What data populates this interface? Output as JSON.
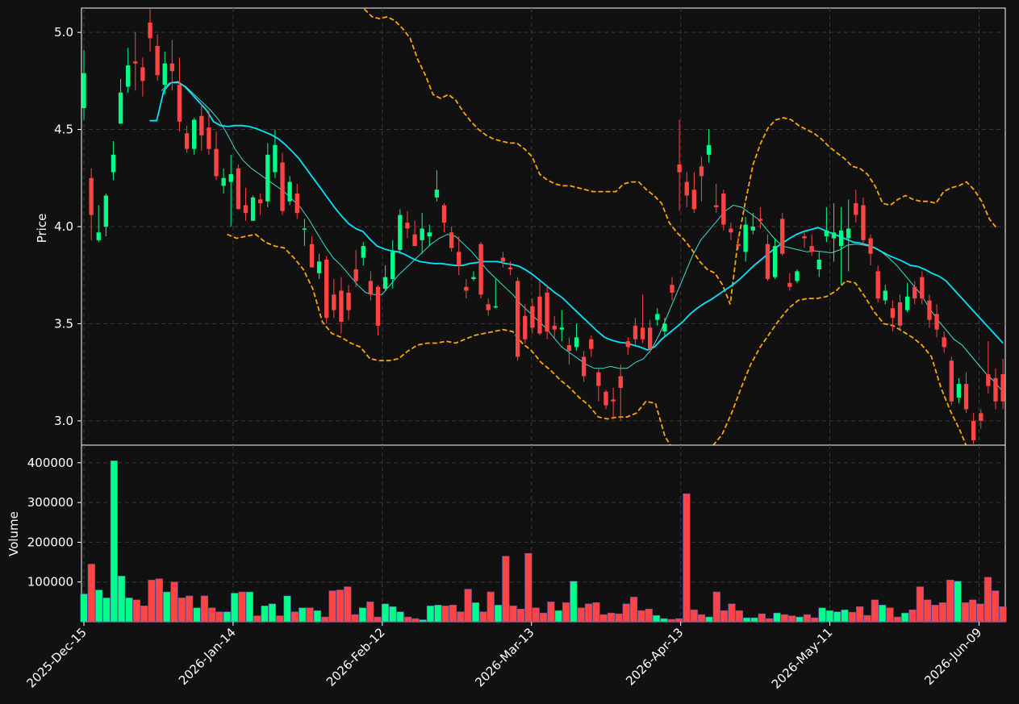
{
  "chart_data": {
    "type": "candlestick",
    "theme": {
      "background": "#111111",
      "up_color": "#00ff88",
      "down_color": "#ff4444",
      "ma_fast_color": "#00e5ff",
      "ma_slow_color": "#40e0d0",
      "band_color": "#ffa500",
      "grid": true
    },
    "price_panel": {
      "ylabel": "Price",
      "ylim": [
        2.875,
        5.125
      ],
      "yticks": [
        3.0,
        3.5,
        4.0,
        4.5,
        5.0
      ],
      "ytick_labels": [
        "3.0",
        "3.5",
        "4.0",
        "4.5",
        "5.0"
      ]
    },
    "volume_panel": {
      "ylabel": "Volume",
      "ylim": [
        0,
        420000
      ],
      "yticks": [
        100000,
        200000,
        300000,
        400000
      ],
      "ytick_labels": [
        "100000",
        "200000",
        "300000",
        "400000"
      ]
    },
    "x_tick_labels": [
      "2025-Dec-15",
      "2026-Jan-14",
      "2026-Feb-12",
      "2026-Mar-13",
      "2026-Apr-13",
      "2026-May-11",
      "2026-Jun-09"
    ],
    "x_tick_index": [
      0,
      25,
      50,
      75,
      100,
      125,
      150
    ],
    "n_bars": 155,
    "candles": [
      [
        4.61,
        4.79,
        4.91,
        4.55
      ],
      [
        4.25,
        4.06,
        4.3,
        3.93
      ],
      [
        3.93,
        3.97,
        4.11,
        3.92
      ],
      [
        4.0,
        4.16,
        4.17,
        3.95
      ],
      [
        4.28,
        4.37,
        4.44,
        4.24
      ],
      [
        4.53,
        4.69,
        4.76,
        4.53
      ],
      [
        4.72,
        4.83,
        4.92,
        4.69
      ],
      [
        4.85,
        4.84,
        5.0,
        4.7
      ],
      [
        4.82,
        4.75,
        4.87,
        4.67
      ],
      [
        5.05,
        4.97,
        5.12,
        4.9
      ],
      [
        4.93,
        4.78,
        4.99,
        4.75
      ],
      [
        4.73,
        4.84,
        4.9,
        4.68
      ],
      [
        4.84,
        4.8,
        4.96,
        4.7
      ],
      [
        4.73,
        4.54,
        4.87,
        4.49
      ],
      [
        4.48,
        4.4,
        4.52,
        4.38
      ],
      [
        4.4,
        4.55,
        4.56,
        4.37
      ],
      [
        4.57,
        4.47,
        4.63,
        4.39
      ],
      [
        4.51,
        4.4,
        4.6,
        4.37
      ],
      [
        4.4,
        4.26,
        4.49,
        4.24
      ],
      [
        4.21,
        4.25,
        4.3,
        4.17
      ],
      [
        4.23,
        4.27,
        4.37,
        4.0
      ],
      [
        4.3,
        4.09,
        4.32,
        4.09
      ],
      [
        4.11,
        4.07,
        4.2,
        4.03
      ],
      [
        4.03,
        4.15,
        4.16,
        4.03
      ],
      [
        4.14,
        4.12,
        4.17,
        4.06
      ],
      [
        4.13,
        4.37,
        4.43,
        4.1
      ],
      [
        4.28,
        4.42,
        4.5,
        4.25
      ],
      [
        4.33,
        4.08,
        4.38,
        4.06
      ],
      [
        4.13,
        4.23,
        4.26,
        4.11
      ],
      [
        4.17,
        4.07,
        4.22,
        4.04
      ],
      [
        3.99,
        3.99,
        4.04,
        3.9
      ],
      [
        3.91,
        3.79,
        3.95,
        3.79
      ],
      [
        3.76,
        3.82,
        3.86,
        3.73
      ],
      [
        3.83,
        3.53,
        3.85,
        3.5
      ],
      [
        3.65,
        3.57,
        3.73,
        3.53
      ],
      [
        3.67,
        3.51,
        3.74,
        3.45
      ],
      [
        3.66,
        3.57,
        3.7,
        3.52
      ],
      [
        3.78,
        3.72,
        3.88,
        3.69
      ],
      [
        3.84,
        3.9,
        3.92,
        3.8
      ],
      [
        3.72,
        3.65,
        3.77,
        3.62
      ],
      [
        3.69,
        3.49,
        3.7,
        3.44
      ],
      [
        3.68,
        3.74,
        3.8,
        3.67
      ],
      [
        3.73,
        3.87,
        3.93,
        3.68
      ],
      [
        3.88,
        4.06,
        4.09,
        3.86
      ],
      [
        4.02,
        3.99,
        4.08,
        3.94
      ],
      [
        3.96,
        3.9,
        4.03,
        3.9
      ],
      [
        3.93,
        3.99,
        4.07,
        3.86
      ],
      [
        3.95,
        3.97,
        4.01,
        3.9
      ],
      [
        4.15,
        4.19,
        4.29,
        4.13
      ],
      [
        4.11,
        4.02,
        4.12,
        3.97
      ],
      [
        3.97,
        3.89,
        4.0,
        3.87
      ],
      [
        3.87,
        3.8,
        3.95,
        3.75
      ],
      [
        3.69,
        3.67,
        3.73,
        3.63
      ],
      [
        3.73,
        3.74,
        3.77,
        3.72
      ],
      [
        3.91,
        3.65,
        3.92,
        3.63
      ],
      [
        3.6,
        3.57,
        3.63,
        3.54
      ],
      [
        3.59,
        3.59,
        3.73,
        3.58
      ],
      [
        3.84,
        3.82,
        3.87,
        3.79
      ],
      [
        3.79,
        3.78,
        3.82,
        3.75
      ],
      [
        3.72,
        3.33,
        3.74,
        3.31
      ],
      [
        3.54,
        3.42,
        3.6,
        3.4
      ],
      [
        3.59,
        3.48,
        3.63,
        3.45
      ],
      [
        3.64,
        3.45,
        3.72,
        3.44
      ],
      [
        3.66,
        3.46,
        3.7,
        3.42
      ],
      [
        3.49,
        3.47,
        3.54,
        3.42
      ],
      [
        3.47,
        3.48,
        3.57,
        3.41
      ],
      [
        3.39,
        3.36,
        3.43,
        3.29
      ],
      [
        3.38,
        3.43,
        3.5,
        3.36
      ],
      [
        3.33,
        3.23,
        3.36,
        3.2
      ],
      [
        3.42,
        3.37,
        3.44,
        3.33
      ],
      [
        3.25,
        3.18,
        3.27,
        3.1
      ],
      [
        3.15,
        3.08,
        3.16,
        3.06
      ],
      [
        3.11,
        3.1,
        3.17,
        3.01
      ],
      [
        3.23,
        3.17,
        3.29,
        3.0
      ],
      [
        3.41,
        3.38,
        3.43,
        3.34
      ],
      [
        3.49,
        3.42,
        3.53,
        3.39
      ],
      [
        3.48,
        3.42,
        3.65,
        3.4
      ],
      [
        3.48,
        3.37,
        3.52,
        3.35
      ],
      [
        3.52,
        3.55,
        3.58,
        3.49
      ],
      [
        3.46,
        3.5,
        3.53,
        3.43
      ],
      [
        3.7,
        3.66,
        3.74,
        3.62
      ],
      [
        4.32,
        4.28,
        4.55,
        4.08
      ],
      [
        4.23,
        4.16,
        4.28,
        4.1
      ],
      [
        4.19,
        4.09,
        4.28,
        4.07
      ],
      [
        4.31,
        4.26,
        4.36,
        4.13
      ],
      [
        4.37,
        4.42,
        4.5,
        4.33
      ],
      [
        4.11,
        4.1,
        4.22,
        4.07
      ],
      [
        4.17,
        4.01,
        4.19,
        3.98
      ],
      [
        3.99,
        3.97,
        4.02,
        3.93
      ],
      [
        3.91,
        3.9,
        3.95,
        3.88
      ],
      [
        3.87,
        4.01,
        4.05,
        3.82
      ],
      [
        3.98,
        4.0,
        4.07,
        3.96
      ],
      [
        4.04,
        4.03,
        4.1,
        3.99
      ],
      [
        3.91,
        3.73,
        3.96,
        3.72
      ],
      [
        3.74,
        3.9,
        3.94,
        3.73
      ],
      [
        4.04,
        3.86,
        4.07,
        3.85
      ],
      [
        3.71,
        3.69,
        3.76,
        3.67
      ],
      [
        3.72,
        3.77,
        3.78,
        3.71
      ],
      [
        3.95,
        3.94,
        3.97,
        3.89
      ],
      [
        3.9,
        3.87,
        3.96,
        3.85
      ],
      [
        3.78,
        3.83,
        3.87,
        3.74
      ],
      [
        3.95,
        3.98,
        4.1,
        3.92
      ],
      [
        3.94,
        3.97,
        4.12,
        3.82
      ],
      [
        3.9,
        3.98,
        4.1,
        3.7
      ],
      [
        3.94,
        3.99,
        4.14,
        3.77
      ],
      [
        4.12,
        4.06,
        4.19,
        4.02
      ],
      [
        4.11,
        3.93,
        4.15,
        3.9
      ],
      [
        3.94,
        3.86,
        3.96,
        3.8
      ],
      [
        3.77,
        3.63,
        3.8,
        3.61
      ],
      [
        3.62,
        3.67,
        3.7,
        3.6
      ],
      [
        3.58,
        3.53,
        3.62,
        3.46
      ],
      [
        3.61,
        3.49,
        3.65,
        3.47
      ],
      [
        3.57,
        3.64,
        3.71,
        3.56
      ],
      [
        3.69,
        3.63,
        3.72,
        3.6
      ],
      [
        3.74,
        3.63,
        3.77,
        3.6
      ],
      [
        3.62,
        3.52,
        3.65,
        3.48
      ],
      [
        3.55,
        3.47,
        3.6,
        3.43
      ],
      [
        3.43,
        3.38,
        3.46,
        3.35
      ],
      [
        3.31,
        3.1,
        3.33,
        3.08
      ],
      [
        3.12,
        3.19,
        3.22,
        3.09
      ],
      [
        3.19,
        3.06,
        3.25,
        3.04
      ],
      [
        3.0,
        2.9,
        3.04,
        2.88
      ],
      [
        3.04,
        3.0,
        3.06,
        2.96
      ],
      [
        3.24,
        3.18,
        3.41,
        3.14
      ],
      [
        3.22,
        3.1,
        3.27,
        3.06
      ],
      [
        3.24,
        3.1,
        3.32,
        3.06
      ]
    ],
    "ma_fast": [
      4.545,
      4.545,
      4.7,
      4.74,
      4.745,
      4.72,
      4.68,
      4.64,
      4.6,
      4.54,
      4.52,
      4.515,
      4.52,
      4.52,
      4.515,
      4.505,
      4.49,
      4.475,
      4.455,
      4.425,
      4.39,
      4.35,
      4.3,
      4.25,
      4.2,
      4.15,
      4.1,
      4.055,
      4.015,
      3.99,
      3.975,
      3.935,
      3.9,
      3.885,
      3.875,
      3.87,
      3.855,
      3.835,
      3.82,
      3.815,
      3.81,
      3.81,
      3.805,
      3.8,
      3.8,
      3.81,
      3.815,
      3.82,
      3.82,
      3.82,
      3.81,
      3.805,
      3.795,
      3.775,
      3.75,
      3.72,
      3.69,
      3.66,
      3.635,
      3.6,
      3.565,
      3.53,
      3.495,
      3.46,
      3.43,
      3.415,
      3.405,
      3.4,
      3.39,
      3.38,
      3.365,
      3.38,
      3.42,
      3.45,
      3.48,
      3.51,
      3.55,
      3.58,
      3.605,
      3.625,
      3.65,
      3.675,
      3.7,
      3.73,
      3.765,
      3.8,
      3.83,
      3.86,
      3.89,
      3.915,
      3.94,
      3.96,
      3.975,
      3.985,
      3.995,
      3.98,
      3.965,
      3.95,
      3.935,
      3.92,
      3.915,
      3.905,
      3.89,
      3.87,
      3.85,
      3.835,
      3.82,
      3.8,
      3.795,
      3.78,
      3.76,
      3.745,
      3.72,
      3.68,
      3.64,
      3.6,
      3.56,
      3.52,
      3.48,
      3.44,
      3.4
    ],
    "ma_slow": [
      4.7,
      4.74,
      4.74,
      4.72,
      4.68,
      4.64,
      4.6,
      4.55,
      4.48,
      4.4,
      4.34,
      4.3,
      4.27,
      4.24,
      4.21,
      4.18,
      4.14,
      4.1,
      4.04,
      3.97,
      3.9,
      3.84,
      3.8,
      3.75,
      3.7,
      3.66,
      3.65,
      3.65,
      3.7,
      3.75,
      3.79,
      3.83,
      3.87,
      3.91,
      3.94,
      3.96,
      3.95,
      3.91,
      3.87,
      3.82,
      3.77,
      3.73,
      3.69,
      3.65,
      3.6,
      3.56,
      3.52,
      3.48,
      3.43,
      3.38,
      3.35,
      3.32,
      3.29,
      3.27,
      3.27,
      3.28,
      3.27,
      3.27,
      3.3,
      3.32,
      3.37,
      3.45,
      3.55,
      3.65,
      3.75,
      3.85,
      3.93,
      3.98,
      4.03,
      4.08,
      4.11,
      4.1,
      4.07,
      4.04,
      3.99,
      3.94,
      3.9,
      3.89,
      3.88,
      3.87,
      3.875,
      3.87,
      3.865,
      3.88,
      3.905,
      3.91,
      3.905,
      3.895,
      3.875,
      3.84,
      3.8,
      3.75,
      3.7,
      3.65,
      3.58,
      3.52,
      3.47,
      3.42,
      3.39,
      3.34,
      3.29,
      3.24,
      3.2,
      3.15
    ],
    "band_upper": [
      5.12,
      5.08,
      5.07,
      5.08,
      5.06,
      5.02,
      4.97,
      4.86,
      4.78,
      4.68,
      4.66,
      4.68,
      4.65,
      4.59,
      4.54,
      4.5,
      4.47,
      4.45,
      4.44,
      4.43,
      4.43,
      4.4,
      4.36,
      4.27,
      4.24,
      4.22,
      4.21,
      4.21,
      4.2,
      4.19,
      4.18,
      4.18,
      4.18,
      4.18,
      4.22,
      4.23,
      4.23,
      4.19,
      4.16,
      4.12,
      4.02,
      3.97,
      3.93,
      3.88,
      3.82,
      3.78,
      3.76,
      3.7,
      3.6,
      3.92,
      4.13,
      4.32,
      4.43,
      4.51,
      4.55,
      4.56,
      4.55,
      4.52,
      4.5,
      4.48,
      4.45,
      4.41,
      4.38,
      4.35,
      4.31,
      4.3,
      4.27,
      4.21,
      4.12,
      4.11,
      4.14,
      4.16,
      4.14,
      4.13,
      4.13,
      4.12,
      4.18,
      4.2,
      4.21,
      4.23,
      4.19,
      4.13,
      4.04,
      3.99
    ],
    "band_lower": [
      3.96,
      3.94,
      3.95,
      3.96,
      3.92,
      3.9,
      3.89,
      3.84,
      3.78,
      3.68,
      3.51,
      3.45,
      3.43,
      3.4,
      3.38,
      3.32,
      3.31,
      3.31,
      3.32,
      3.36,
      3.39,
      3.4,
      3.4,
      3.41,
      3.4,
      3.42,
      3.44,
      3.45,
      3.46,
      3.47,
      3.46,
      3.4,
      3.36,
      3.3,
      3.26,
      3.21,
      3.17,
      3.12,
      3.08,
      3.02,
      3.01,
      3.02,
      3.02,
      3.04,
      3.1,
      3.09,
      2.92,
      2.84,
      2.82,
      2.82,
      2.84,
      2.87,
      2.93,
      3.04,
      3.17,
      3.29,
      3.38,
      3.45,
      3.52,
      3.58,
      3.62,
      3.63,
      3.63,
      3.64,
      3.67,
      3.72,
      3.71,
      3.64,
      3.56,
      3.5,
      3.49,
      3.46,
      3.43,
      3.39,
      3.33,
      3.17,
      3.05,
      2.95,
      2.83,
      2.83
    ],
    "volume": [
      70000,
      145000,
      80000,
      60000,
      405000,
      115000,
      60000,
      55000,
      40000,
      105000,
      108000,
      75000,
      100000,
      60000,
      65000,
      35000,
      65000,
      35000,
      25000,
      25000,
      72000,
      75000,
      75000,
      15000,
      40000,
      45000,
      15000,
      65000,
      25000,
      35000,
      35000,
      28000,
      12000,
      78000,
      80000,
      88000,
      18000,
      35000,
      50000,
      12000,
      45000,
      38000,
      25000,
      12000,
      8000,
      5000,
      40000,
      42000,
      40000,
      42000,
      25000,
      82000,
      48000,
      25000,
      75000,
      42000,
      165000,
      40000,
      32000,
      172000,
      35000,
      22000,
      50000,
      28000,
      48000,
      102000,
      35000,
      45000,
      48000,
      18000,
      22000,
      20000,
      45000,
      62000,
      28000,
      32000,
      16000,
      8000,
      6000,
      8000,
      322000,
      30000,
      18000,
      12000,
      75000,
      28000,
      45000,
      28000,
      10000,
      10000,
      20000,
      8000,
      22000,
      18000,
      15000,
      12000,
      18000,
      10000,
      35000,
      28000,
      25000,
      30000,
      24000,
      38000,
      16000,
      55000,
      42000,
      35000,
      12000,
      22000,
      30000,
      88000,
      55000,
      42000,
      48000,
      105000,
      102000,
      48000,
      55000,
      45000,
      112000,
      78000,
      38000
    ]
  }
}
